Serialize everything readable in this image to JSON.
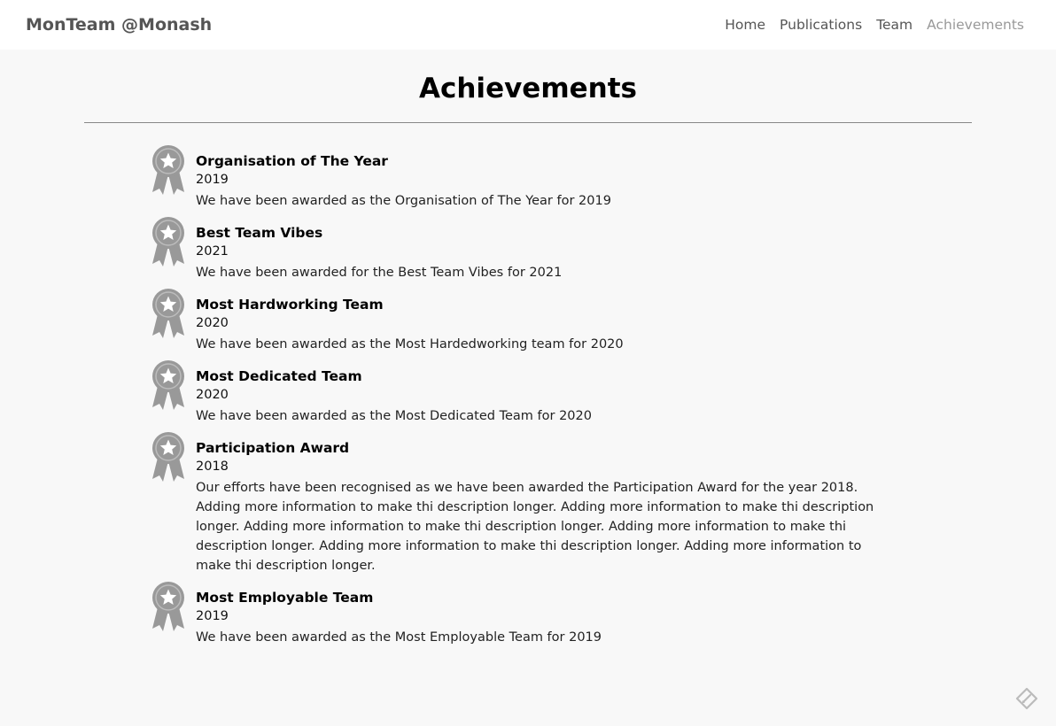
{
  "navbar": {
    "brand": "MonTeam @Monash",
    "links": [
      {
        "label": "Home",
        "active": false
      },
      {
        "label": "Publications",
        "active": false
      },
      {
        "label": "Team",
        "active": false
      },
      {
        "label": "Achievements",
        "active": true
      }
    ]
  },
  "page": {
    "title": "Achievements"
  },
  "achievements": [
    {
      "title": "Organisation of The Year",
      "year": "2019",
      "description": "We have been awarded as the Organisation of The Year for 2019",
      "icon": "medal-icon"
    },
    {
      "title": "Best Team Vibes",
      "year": "2021",
      "description": "We have been awarded for the Best Team Vibes for 2021",
      "icon": "medal-icon"
    },
    {
      "title": "Most Hardworking Team",
      "year": "2020",
      "description": "We have been awarded as the Most Hardedworking team for 2020",
      "icon": "medal-icon"
    },
    {
      "title": "Most Dedicated Team",
      "year": "2020",
      "description": "We have been awarded as the Most Dedicated Team for 2020",
      "icon": "medal-icon"
    },
    {
      "title": "Participation Award",
      "year": "2018",
      "description": "Our efforts have been recognised as we have been awarded the Participation Award for the year 2018. Adding more information to make thi description longer. Adding more information to make thi description longer. Adding more information to make thi description longer. Adding more information to make thi description longer. Adding more information to make thi description longer. Adding more information to make thi description longer.",
      "icon": "medal-icon"
    },
    {
      "title": "Most Employable Team",
      "year": "2019",
      "description": "We have been awarded as the Most Employable Team for 2019",
      "icon": "medal-icon"
    }
  ],
  "colors": {
    "medal": "#999999",
    "nav_text": "#555555",
    "nav_active": "#999999",
    "background": "#f8f8f8"
  }
}
